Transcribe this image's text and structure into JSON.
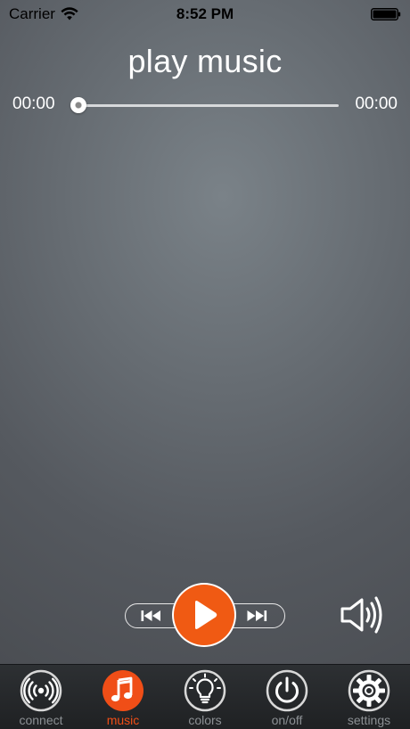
{
  "status_bar": {
    "carrier": "Carrier",
    "time": "8:52 PM",
    "wifi_icon": "wifi-icon",
    "battery_icon": "battery-icon"
  },
  "player": {
    "title": "play music",
    "elapsed": "00:00",
    "duration": "00:00",
    "progress": 0,
    "accent_color": "#f05a13",
    "prev_icon": "previous-track-icon",
    "play_icon": "play-icon",
    "next_icon": "next-track-icon",
    "volume_icon": "speaker-volume-icon"
  },
  "tab_bar": {
    "active_color": "#f04e17",
    "inactive_color": "#8c9094",
    "tabs": [
      {
        "label": "connect",
        "icon": "wireless-signal-icon",
        "active": false
      },
      {
        "label": "music",
        "icon": "music-note-icon",
        "active": true
      },
      {
        "label": "colors",
        "icon": "light-bulb-icon",
        "active": false
      },
      {
        "label": "on/off",
        "icon": "power-icon",
        "active": false
      },
      {
        "label": "settings",
        "icon": "gear-icon",
        "active": false
      }
    ]
  }
}
